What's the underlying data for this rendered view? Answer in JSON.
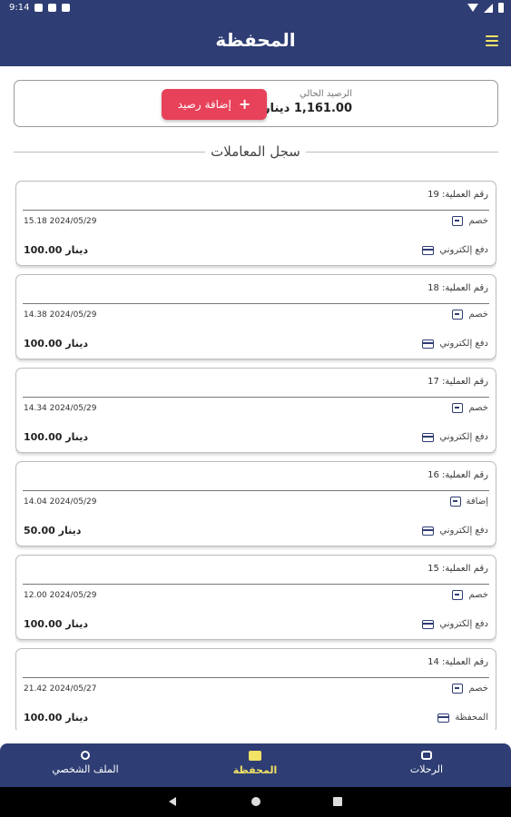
{
  "status_bar": {
    "time": "9:14"
  },
  "app_bar": {
    "title": "المحفظة",
    "menu_icon": "hamburger-menu-icon"
  },
  "balance": {
    "label": "الرصيد الحالي",
    "value": "1,161.00 دينار",
    "add_button_label": "إضافة رصيد",
    "add_button_icon": "plus-icon"
  },
  "section_title": "سجل المعاملات",
  "transactions": [
    {
      "id_label": "رقم العملية: 19",
      "type": "خصم",
      "date": "15.18 2024/05/29",
      "method": "دفع إلكتروني",
      "amount": "100.00 دينار"
    },
    {
      "id_label": "رقم العملية: 18",
      "type": "خصم",
      "date": "14.38 2024/05/29",
      "method": "دفع إلكتروني",
      "amount": "100.00 دينار"
    },
    {
      "id_label": "رقم العملية: 17",
      "type": "خصم",
      "date": "14.34 2024/05/29",
      "method": "دفع إلكتروني",
      "amount": "100.00 دينار"
    },
    {
      "id_label": "رقم العملية: 16",
      "type": "إضافة",
      "date": "14.04 2024/05/29",
      "method": "دفع إلكتروني",
      "amount": "50.00 دينار"
    },
    {
      "id_label": "رقم العملية: 15",
      "type": "خصم",
      "date": "12.00 2024/05/29",
      "method": "دفع إلكتروني",
      "amount": "100.00 دينار"
    },
    {
      "id_label": "رقم العملية: 14",
      "type": "خصم",
      "date": "21.42 2024/05/27",
      "method": "المحفظة",
      "amount": "100.00 دينار"
    }
  ],
  "bottom_nav": {
    "profile": "الملف الشخصي",
    "wallet": "المحفظة",
    "trips": "الرحلات"
  },
  "colors": {
    "primary": "#2e3d73",
    "accent": "#e8415a",
    "highlight": "#f2e265"
  }
}
